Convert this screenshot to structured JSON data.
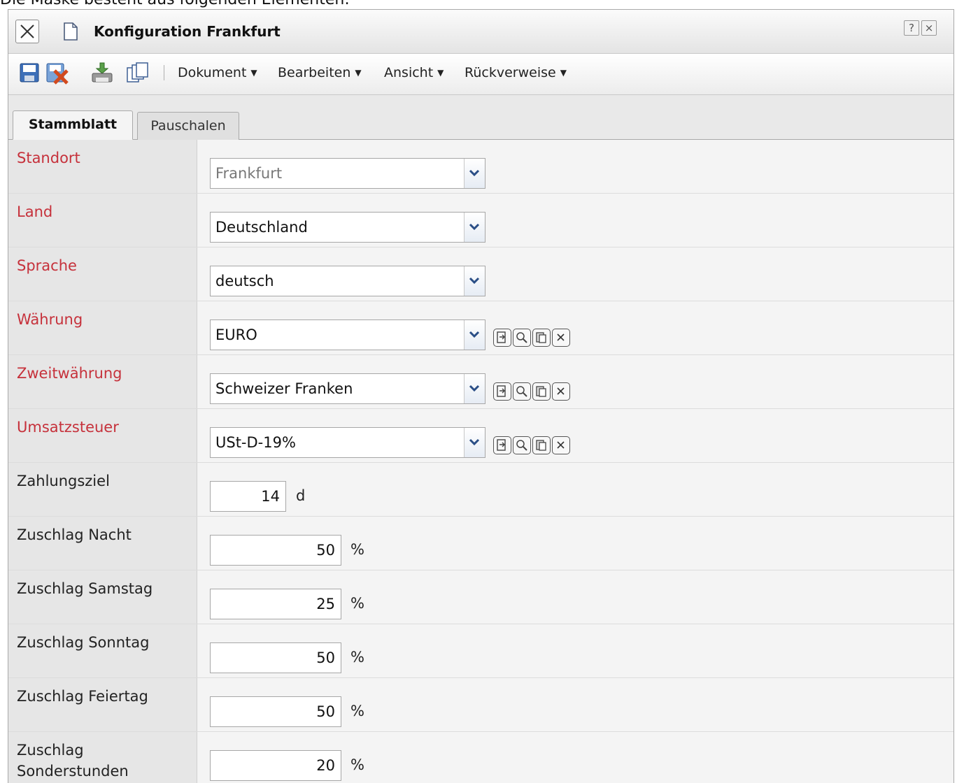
{
  "caption": "Die Maske besteht aus folgenden Elementen:",
  "window": {
    "title": "Konfiguration Frankfurt",
    "help_label": "?",
    "close_label": "×"
  },
  "toolbar": {
    "menus": {
      "dokument": "Dokument",
      "bearbeiten": "Bearbeiten",
      "ansicht": "Ansicht",
      "rueckverweise": "Rückverweise"
    },
    "arrow": "▼"
  },
  "tabs": {
    "stammblatt": "Stammblatt",
    "pauschalen": "Pauschalen"
  },
  "form": {
    "standort": {
      "label": "Standort",
      "value": "Frankfurt"
    },
    "land": {
      "label": "Land",
      "value": "Deutschland"
    },
    "sprache": {
      "label": "Sprache",
      "value": "deutsch"
    },
    "waehrung": {
      "label": "Währung",
      "value": "EURO"
    },
    "zweitwaehrung": {
      "label": "Zweitwährung",
      "value": "Schweizer Franken"
    },
    "umsatzsteuer": {
      "label": "Umsatzsteuer",
      "value": "USt-D-19%"
    },
    "zahlungsziel": {
      "label": "Zahlungsziel",
      "value": "14",
      "unit": "d"
    },
    "zuschlag_nacht": {
      "label": "Zuschlag Nacht",
      "value": "50",
      "unit": "%"
    },
    "zuschlag_samstag": {
      "label": "Zuschlag Samstag",
      "value": "25",
      "unit": "%"
    },
    "zuschlag_sonntag": {
      "label": "Zuschlag Sonntag",
      "value": "50",
      "unit": "%"
    },
    "zuschlag_feiertag": {
      "label": "Zuschlag Feiertag",
      "value": "50",
      "unit": "%"
    },
    "zuschlag_sonderstunden": {
      "label_line1": "Zuschlag",
      "label_line2": "Sonderstunden",
      "value": "20",
      "unit": "%"
    }
  },
  "colors": {
    "required_label": "#c6313b",
    "optional_label": "#222222",
    "label_bg": "#e6e6e6",
    "field_bg": "#f4f4f4"
  }
}
